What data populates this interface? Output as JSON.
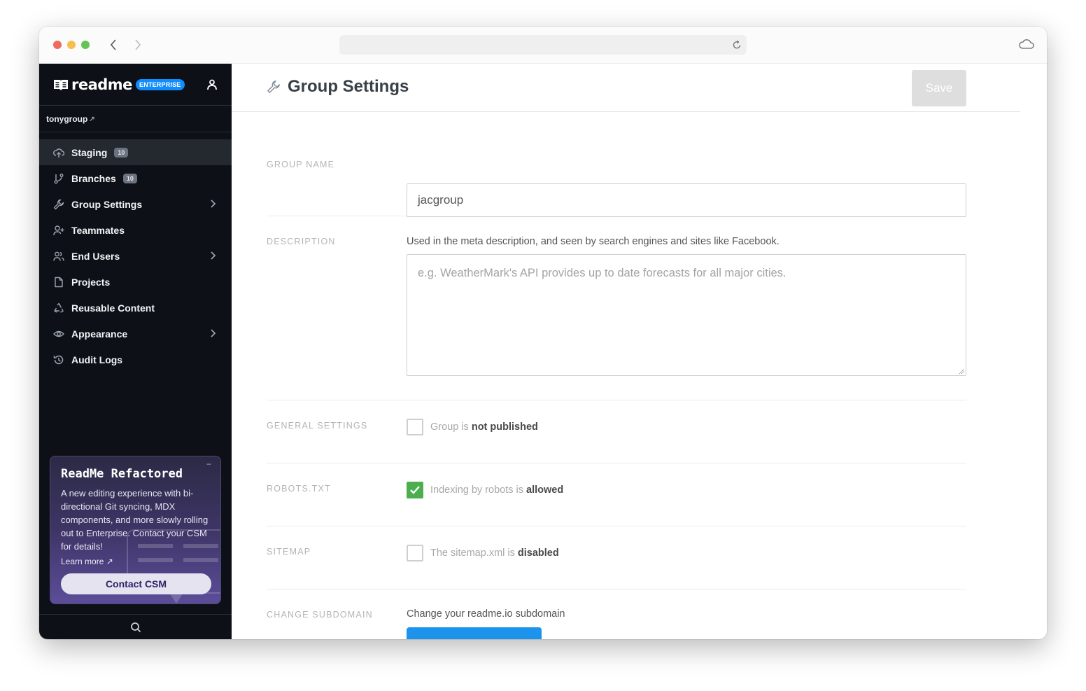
{
  "browser": {
    "url": "",
    "icons": {
      "back": "chevron-left-icon",
      "forward": "chevron-right-icon",
      "reload": "reload-icon",
      "cloud": "cloud-icon"
    }
  },
  "sidebar": {
    "brand": "readme",
    "badge": "ENTERPRISE",
    "group_link": "tonygroup",
    "group_link_arrow": "↗",
    "items": [
      {
        "label": "Staging",
        "count": "10",
        "icon": "cloud-upload-icon",
        "active": true
      },
      {
        "label": "Branches",
        "count": "10",
        "icon": "git-branch-icon"
      },
      {
        "label": "Group Settings",
        "icon": "wrench-icon",
        "chevron": true
      },
      {
        "label": "Teammates",
        "icon": "user-plus-icon"
      },
      {
        "label": "End Users",
        "icon": "users-icon",
        "chevron": true
      },
      {
        "label": "Projects",
        "icon": "file-icon"
      },
      {
        "label": "Reusable Content",
        "icon": "recycle-icon"
      },
      {
        "label": "Appearance",
        "icon": "eye-icon",
        "chevron": true
      },
      {
        "label": "Audit Logs",
        "icon": "history-icon"
      }
    ],
    "promo": {
      "title": "ReadMe Refactored",
      "body": "A new editing experience with bi-directional Git syncing, MDX components, and more slowly rolling out to Enterprise. Contact your CSM for details!",
      "learn_more": "Learn more ↗",
      "button": "Contact CSM",
      "close": "−"
    }
  },
  "main": {
    "title": "Group Settings",
    "save": "Save",
    "group_name": {
      "label": "Group Name",
      "value": "jacgroup"
    },
    "description": {
      "label": "Description",
      "help": "Used in the meta description, and seen by search engines and sites like Facebook.",
      "placeholder": "e.g. WeatherMark's API provides up to date forecasts for all major cities.",
      "value": ""
    },
    "general_settings": {
      "label": "General Settings",
      "prefix": "Group is ",
      "status": "not published",
      "checked": false
    },
    "robots": {
      "label": "Robots.txt",
      "prefix": "Indexing by robots is ",
      "status": "allowed",
      "checked": true
    },
    "sitemap": {
      "label": "Sitemap",
      "prefix": "The sitemap.xml is ",
      "status": "disabled",
      "checked": false
    },
    "subdomain": {
      "label": "Change Subdomain",
      "help": "Change your readme.io subdomain"
    }
  }
}
